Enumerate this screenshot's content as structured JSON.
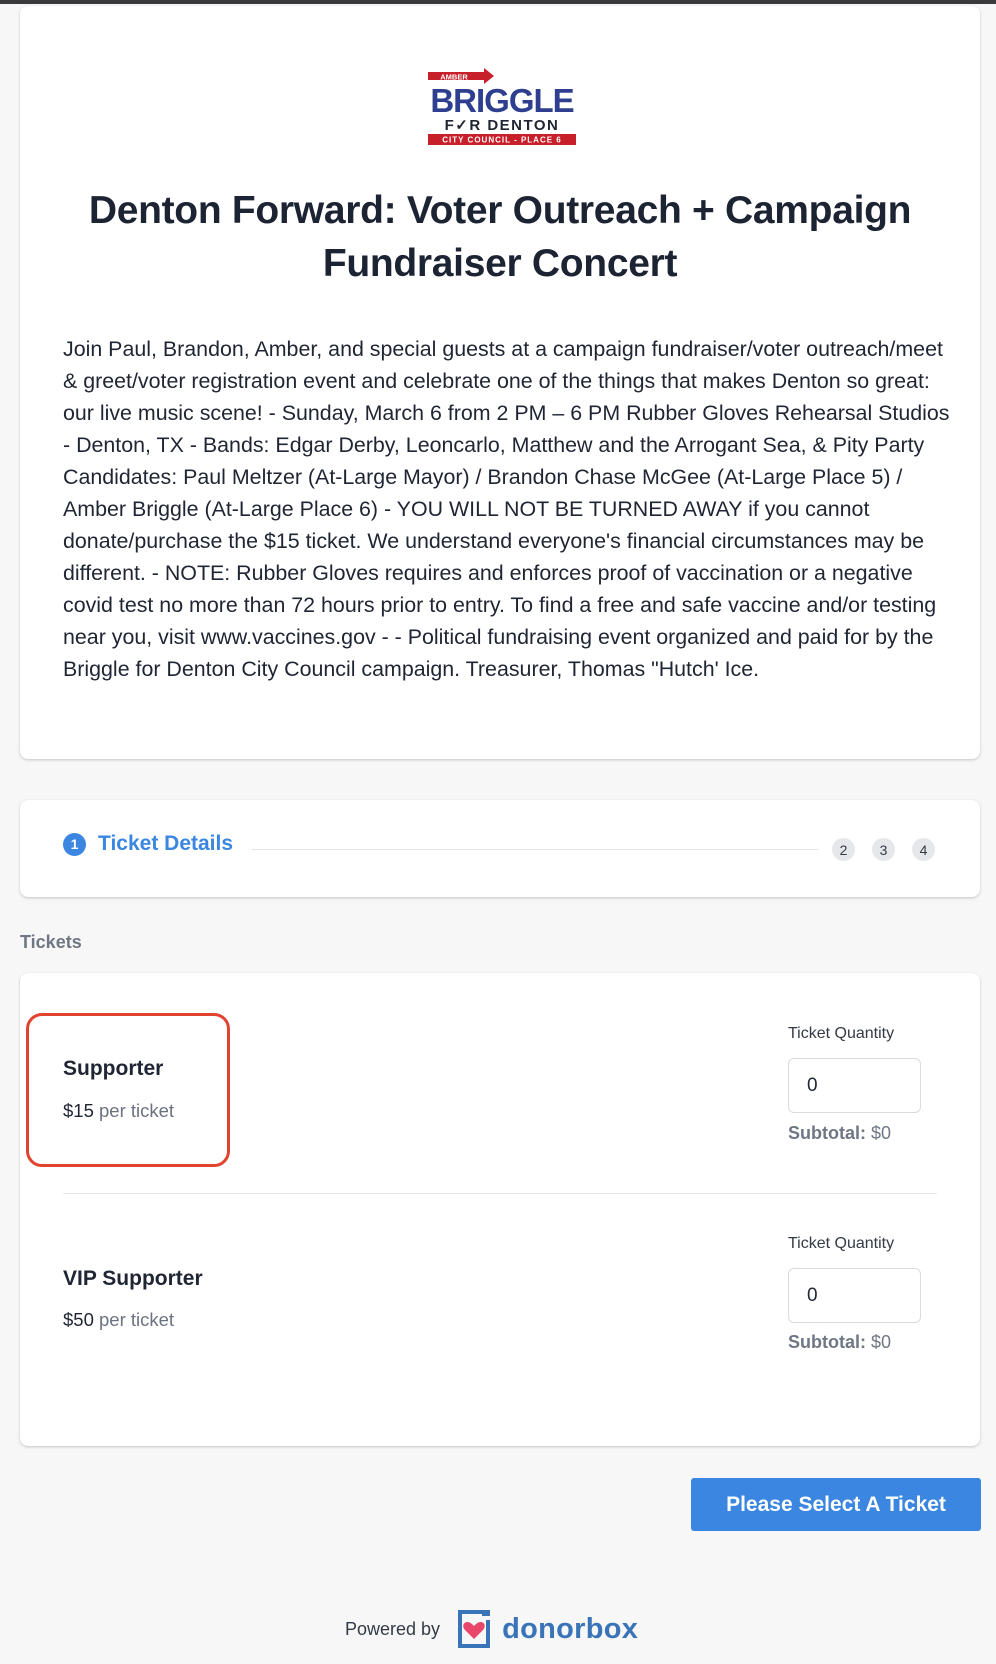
{
  "colors": {
    "accent": "#3a86e0",
    "highlight": "#e0442f",
    "brand_blue": "#2e3f8f",
    "brand_red": "#c8202a"
  },
  "logo": {
    "top_text": "AMBER",
    "main_text": "BRIGGLE",
    "sub_text": "F✓R DENTON",
    "bottom_text": "CITY COUNCIL - PLACE 6"
  },
  "event": {
    "title": "Denton Forward: Voter Outreach + Campaign Fundraiser Concert",
    "description": "Join Paul, Brandon, Amber, and special guests at a campaign fundraiser/voter outreach/meet & greet/voter registration event and celebrate one of the things that makes Denton so great: our live music scene! - Sunday, March 6 from 2 PM – 6 PM Rubber Gloves Rehearsal Studios - Denton, TX - Bands: Edgar Derby, Leoncarlo, Matthew and the Arrogant Sea, & Pity Party Candidates: Paul Meltzer (At-Large Mayor) / Brandon Chase McGee (At-Large Place 5) / Amber Briggle (At-Large Place 6) - YOU WILL NOT BE TURNED AWAY if you cannot donate/purchase the $15 ticket. We understand everyone's financial circumstances may be different. - NOTE: Rubber Gloves requires and enforces proof of vaccination or a negative covid test no more than 72 hours prior to entry. To find a free and safe vaccine and/or testing near you, visit www.vaccines.gov - - Political fundraising event organized and paid for by the Briggle for Denton City Council campaign. Treasurer, Thomas \"Hutch' Ice."
  },
  "stepper": {
    "active_number": "1",
    "active_label": "Ticket Details",
    "steps": [
      "2",
      "3",
      "4"
    ]
  },
  "tickets_section_label": "Tickets",
  "tickets": [
    {
      "name": "Supporter",
      "price": "$15",
      "per": "per ticket",
      "qty_label": "Ticket Quantity",
      "qty_value": "0",
      "subtotal_label": "Subtotal:",
      "subtotal_value": "$0"
    },
    {
      "name": "VIP Supporter",
      "price": "$50",
      "per": "per ticket",
      "qty_label": "Ticket Quantity",
      "qty_value": "0",
      "subtotal_label": "Subtotal:",
      "subtotal_value": "$0"
    }
  ],
  "cta_label": "Please Select A Ticket",
  "footer": {
    "powered_by": "Powered by",
    "brand": "donorbox"
  }
}
